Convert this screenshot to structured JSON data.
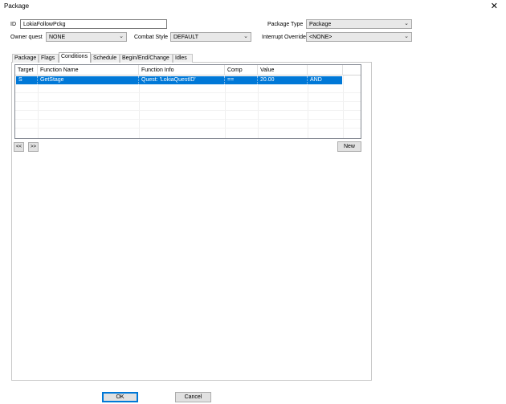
{
  "window": {
    "title": "Package",
    "close_glyph": "✕"
  },
  "form": {
    "id_label": "ID",
    "id_value": "LokiaFollowPckg",
    "package_type_label": "Package Type",
    "package_type_value": "Package",
    "owner_quest_label": "Owner quest",
    "owner_quest_value": "NONE",
    "combat_style_label": "Combat Style",
    "combat_style_value": "DEFAULT",
    "interrupt_override_label": "Interrupt Override",
    "interrupt_override_value": "<NONE>"
  },
  "tabs": [
    {
      "label": "Package"
    },
    {
      "label": "Flags"
    },
    {
      "label": "Conditions"
    },
    {
      "label": "Schedule"
    },
    {
      "label": "Begin/End/Change"
    },
    {
      "label": "Idles"
    }
  ],
  "active_tab": "Conditions",
  "conditions": {
    "columns": [
      "Target",
      "Function Name",
      "Function Info",
      "Comp",
      "Value",
      ""
    ],
    "rows": [
      {
        "target": "S",
        "function_name": "GetStage",
        "function_info": "Quest: 'LokiaQuestID'",
        "comp": "==",
        "value": "20.00",
        "flag": "AND",
        "selected": true
      }
    ]
  },
  "buttons": {
    "prev_label": "<<",
    "next_label": ">>",
    "new_label": "New",
    "ok_label": "OK",
    "cancel_label": "Cancel"
  },
  "icons": {
    "combo_arrow": "chevron-down-icon",
    "close": "close-icon"
  },
  "colors": {
    "selection": "#0078d7",
    "default_button_border": "#0078d7"
  }
}
